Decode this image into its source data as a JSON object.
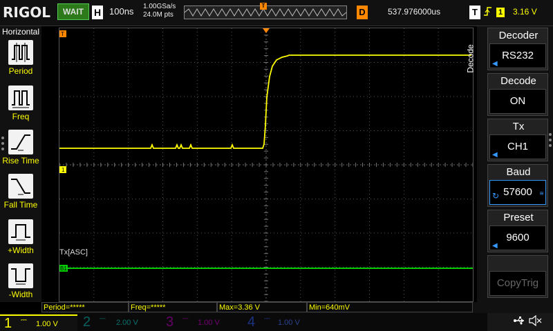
{
  "brand": "RIGOL",
  "status": "WAIT",
  "horizontal": {
    "label": "H",
    "timebase": "100ns"
  },
  "sample": {
    "rate": "1.00GSa/s",
    "points": "24.0M pts"
  },
  "trigger_marker": "T",
  "delay": {
    "label": "D",
    "value": "537.976000us"
  },
  "trigger": {
    "label": "T",
    "edge": "⨏",
    "channel": "1",
    "level": "3.16 V"
  },
  "left_menu": {
    "title": "Horizontal",
    "items": [
      {
        "label": "Period",
        "icon": "period-icon"
      },
      {
        "label": "Freq",
        "icon": "freq-icon"
      },
      {
        "label": "Rise Time",
        "icon": "rise-time-icon"
      },
      {
        "label": "Fall Time",
        "icon": "fall-time-icon"
      },
      {
        "label": "+Width",
        "icon": "pos-width-icon"
      },
      {
        "label": "-Width",
        "icon": "neg-width-icon"
      }
    ]
  },
  "right_menu": {
    "tab": "Decode",
    "items": [
      {
        "title": "Decoder",
        "value": "RS232"
      },
      {
        "title": "Decode",
        "value": "ON"
      },
      {
        "title": "Tx",
        "value": "CH1"
      },
      {
        "title": "Baud",
        "value": "57600"
      },
      {
        "title": "Preset",
        "value": "9600"
      },
      {
        "title": "",
        "value": "CopyTrig"
      }
    ]
  },
  "grid_labels": {
    "trigger_tag": "T",
    "ch1_tag": "1",
    "bus_tag": "B1",
    "bus_label": "Tx[ASC]"
  },
  "measurements": [
    {
      "text": "Period=*****"
    },
    {
      "text": "Freq=*****"
    },
    {
      "text": "Max=3.36 V"
    },
    {
      "text": "Min=640mV"
    }
  ],
  "channels": [
    {
      "num": "1",
      "scale": "1.00 V",
      "color": "#ffff00"
    },
    {
      "num": "2",
      "scale": "2.00 V",
      "color": "#00cccc"
    },
    {
      "num": "3",
      "scale": "1.00 V",
      "color": "#cc00cc"
    },
    {
      "num": "4",
      "scale": "1.00 V",
      "color": "#3366ff"
    }
  ],
  "colors": {
    "ch1": "#ffff00",
    "bus": "#00cc00",
    "trigger": "#ff8800",
    "accent": "#3399ff"
  }
}
